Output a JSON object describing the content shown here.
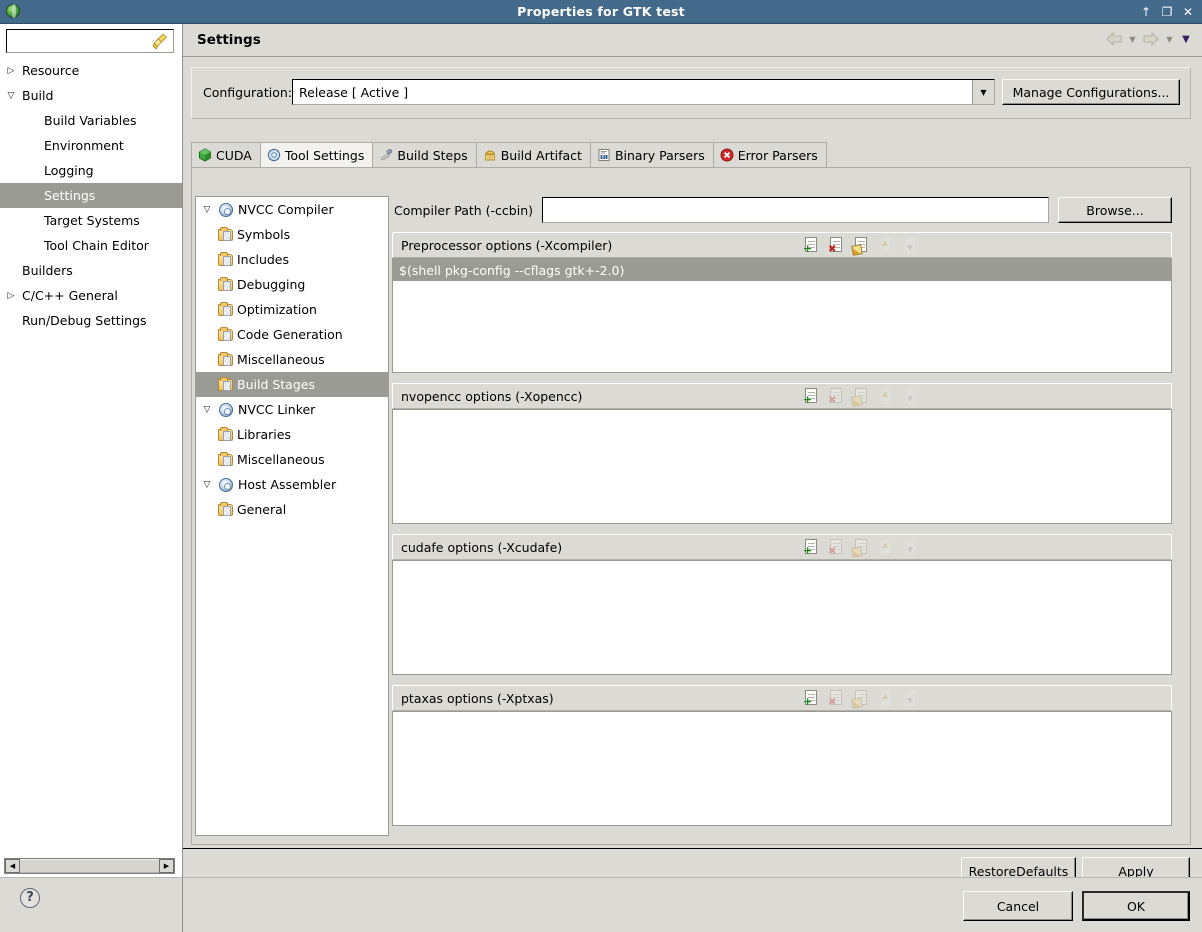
{
  "window": {
    "title": "Properties for GTK test",
    "icon": "app-globe-icon",
    "buttons": {
      "minimize": "↑",
      "maximize": "❐",
      "close": "✕"
    }
  },
  "sidebar": {
    "filter_value": "",
    "filter_placeholder": "",
    "clear_icon": "broom-icon",
    "items": [
      {
        "label": "Resource",
        "level": 0,
        "twisty": "collapsed",
        "selected": false
      },
      {
        "label": "Build",
        "level": 0,
        "twisty": "expanded",
        "selected": false
      },
      {
        "label": "Build Variables",
        "level": 1,
        "twisty": "none",
        "selected": false
      },
      {
        "label": "Environment",
        "level": 1,
        "twisty": "none",
        "selected": false
      },
      {
        "label": "Logging",
        "level": 1,
        "twisty": "none",
        "selected": false
      },
      {
        "label": "Settings",
        "level": 1,
        "twisty": "none",
        "selected": true
      },
      {
        "label": "Target Systems",
        "level": 1,
        "twisty": "none",
        "selected": false
      },
      {
        "label": "Tool Chain Editor",
        "level": 1,
        "twisty": "none",
        "selected": false
      },
      {
        "label": "Builders",
        "level": 0,
        "twisty": "none",
        "selected": false
      },
      {
        "label": "C/C++ General",
        "level": 0,
        "twisty": "collapsed",
        "selected": false
      },
      {
        "label": "Run/Debug Settings",
        "level": 0,
        "twisty": "none",
        "selected": false
      }
    ],
    "help_button": "?"
  },
  "header": {
    "title": "Settings",
    "nav": {
      "back_icon": "back-arrow-icon",
      "back_menu_icon": "chevron-down-icon",
      "forward_icon": "forward-arrow-icon",
      "forward_menu_icon": "chevron-down-icon",
      "view_menu_icon": "chevron-down-icon"
    }
  },
  "config": {
    "label": "Configuration:",
    "value": "Release  [ Active ]",
    "dropdown_icon": "chevron-down-icon",
    "manage_label": "Manage Configurations..."
  },
  "tabs": [
    {
      "label": "CUDA",
      "icon": "cuda-cube-icon",
      "active": false
    },
    {
      "label": "Tool Settings",
      "icon": "gear-icon",
      "active": true
    },
    {
      "label": "Build Steps",
      "icon": "hammer-icon",
      "active": false
    },
    {
      "label": "Build Artifact",
      "icon": "artifact-icon",
      "active": false
    },
    {
      "label": "Binary Parsers",
      "icon": "binary-icon",
      "active": false
    },
    {
      "label": "Error Parsers",
      "icon": "error-circle-icon",
      "active": false
    }
  ],
  "tool_tree": [
    {
      "label": "NVCC Compiler",
      "level": 0,
      "twisty": "expanded",
      "icon": "gear-icon",
      "selected": false
    },
    {
      "label": "Symbols",
      "level": 1,
      "twisty": "none",
      "icon": "folder-icon",
      "selected": false
    },
    {
      "label": "Includes",
      "level": 1,
      "twisty": "none",
      "icon": "folder-icon",
      "selected": false
    },
    {
      "label": "Debugging",
      "level": 1,
      "twisty": "none",
      "icon": "folder-icon",
      "selected": false
    },
    {
      "label": "Optimization",
      "level": 1,
      "twisty": "none",
      "icon": "folder-icon",
      "selected": false
    },
    {
      "label": "Code Generation",
      "level": 1,
      "twisty": "none",
      "icon": "folder-icon",
      "selected": false
    },
    {
      "label": "Miscellaneous",
      "level": 1,
      "twisty": "none",
      "icon": "folder-icon",
      "selected": false
    },
    {
      "label": "Build Stages",
      "level": 1,
      "twisty": "none",
      "icon": "folder-icon",
      "selected": true
    },
    {
      "label": "NVCC Linker",
      "level": 0,
      "twisty": "expanded",
      "icon": "gear-icon",
      "selected": false
    },
    {
      "label": "Libraries",
      "level": 1,
      "twisty": "none",
      "icon": "folder-icon",
      "selected": false
    },
    {
      "label": "Miscellaneous",
      "level": 1,
      "twisty": "none",
      "icon": "folder-icon",
      "selected": false
    },
    {
      "label": "Host Assembler",
      "level": 0,
      "twisty": "expanded",
      "icon": "gear-icon",
      "selected": false
    },
    {
      "label": "General",
      "level": 1,
      "twisty": "none",
      "icon": "folder-icon",
      "selected": false
    }
  ],
  "compiler_path": {
    "label": "Compiler Path (-ccbin)",
    "value": "",
    "browse_label": "Browse..."
  },
  "option_groups": [
    {
      "title": "Preprocessor options (-Xcompiler)",
      "buttons": [
        {
          "name": "add-option-button",
          "icon": "document-add-icon",
          "enabled": true
        },
        {
          "name": "delete-option-button",
          "icon": "document-delete-icon",
          "enabled": true
        },
        {
          "name": "edit-option-button",
          "icon": "document-edit-icon",
          "enabled": true
        },
        {
          "name": "move-up-button",
          "icon": "arrow-up-icon",
          "enabled": false
        },
        {
          "name": "move-down-button",
          "icon": "arrow-down-icon",
          "enabled": false
        }
      ],
      "items": [
        "$(shell pkg-config --cflags gtk+-2.0)"
      ],
      "selected_index": 0
    },
    {
      "title": "nvopencc options (-Xopencc)",
      "buttons": [
        {
          "name": "add-option-button",
          "icon": "document-add-icon",
          "enabled": true
        },
        {
          "name": "delete-option-button",
          "icon": "document-delete-icon",
          "enabled": false
        },
        {
          "name": "edit-option-button",
          "icon": "document-edit-icon",
          "enabled": false
        },
        {
          "name": "move-up-button",
          "icon": "arrow-up-icon",
          "enabled": false
        },
        {
          "name": "move-down-button",
          "icon": "arrow-down-icon",
          "enabled": false
        }
      ],
      "items": [],
      "selected_index": -1
    },
    {
      "title": "cudafe options (-Xcudafe)",
      "buttons": [
        {
          "name": "add-option-button",
          "icon": "document-add-icon",
          "enabled": true
        },
        {
          "name": "delete-option-button",
          "icon": "document-delete-icon",
          "enabled": false
        },
        {
          "name": "edit-option-button",
          "icon": "document-edit-icon",
          "enabled": false
        },
        {
          "name": "move-up-button",
          "icon": "arrow-up-icon",
          "enabled": false
        },
        {
          "name": "move-down-button",
          "icon": "arrow-down-icon",
          "enabled": false
        }
      ],
      "items": [],
      "selected_index": -1
    },
    {
      "title": "ptaxas options (-Xptxas)",
      "buttons": [
        {
          "name": "add-option-button",
          "icon": "document-add-icon",
          "enabled": true
        },
        {
          "name": "delete-option-button",
          "icon": "document-delete-icon",
          "enabled": false
        },
        {
          "name": "edit-option-button",
          "icon": "document-edit-icon",
          "enabled": false
        },
        {
          "name": "move-up-button",
          "icon": "arrow-up-icon",
          "enabled": false
        },
        {
          "name": "move-down-button",
          "icon": "arrow-down-icon",
          "enabled": false
        }
      ],
      "items": [],
      "selected_index": -1
    }
  ],
  "apply_bar": {
    "restore_defaults_prefix": "Restore ",
    "restore_defaults_mnemonic": "D",
    "restore_defaults_suffix": "efaults",
    "apply_mnemonic": "A",
    "apply_suffix": "pply"
  },
  "footer": {
    "cancel_label": "Cancel",
    "ok_label": "OK"
  },
  "colors": {
    "titlebar": "#436a8a",
    "window_bg": "#dcdad5",
    "selection": "#9b9b95",
    "selection_text": "#ffffff",
    "field_bg": "#ffffff"
  }
}
